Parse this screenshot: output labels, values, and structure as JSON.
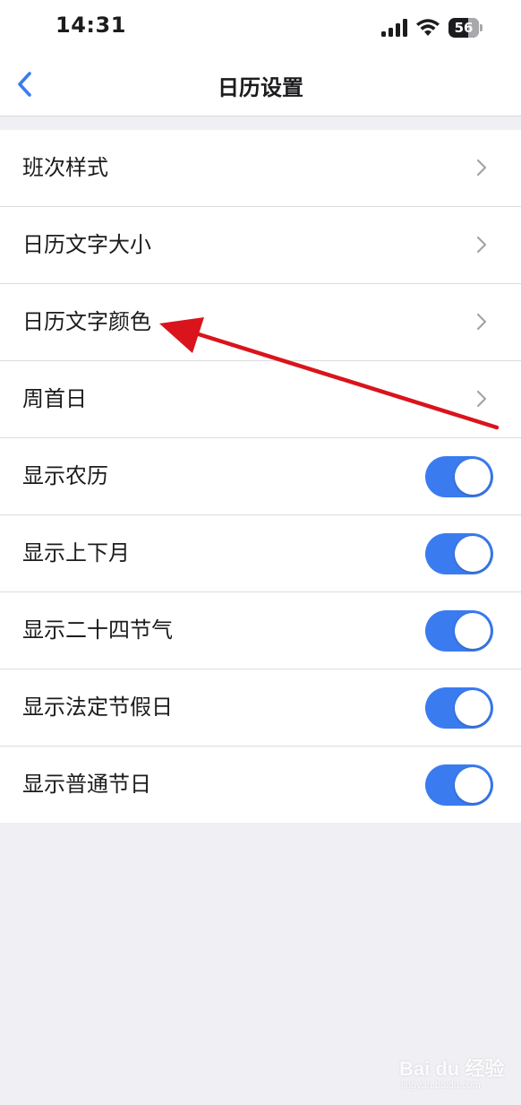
{
  "status_bar": {
    "time": "14:31",
    "battery_level": "56",
    "icons": [
      "signal-icon",
      "wifi-icon",
      "battery-icon"
    ]
  },
  "nav": {
    "title": "日历设置",
    "back_icon": "chevron-left-icon"
  },
  "settings": {
    "rows": [
      {
        "label": "班次样式",
        "control": "chevron"
      },
      {
        "label": "日历文字大小",
        "control": "chevron"
      },
      {
        "label": "日历文字颜色",
        "control": "chevron"
      },
      {
        "label": "周首日",
        "control": "chevron"
      },
      {
        "label": "显示农历",
        "control": "toggle",
        "on": true
      },
      {
        "label": "显示上下月",
        "control": "toggle",
        "on": true
      },
      {
        "label": "显示二十四节气",
        "control": "toggle",
        "on": true
      },
      {
        "label": "显示法定节假日",
        "control": "toggle",
        "on": true
      },
      {
        "label": "显示普通节日",
        "control": "toggle",
        "on": true
      }
    ]
  },
  "watermark": {
    "logo": "Bai du 经验",
    "sub": "jingyan.baidu.com"
  },
  "colors": {
    "accent": "#3a7cf0",
    "background": "#efeff4",
    "annotation": "#d9141c"
  }
}
